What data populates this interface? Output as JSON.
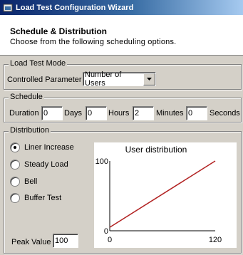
{
  "window": {
    "title": "Load Test Configuration Wizard"
  },
  "header": {
    "title": "Schedule & Distribution",
    "subtitle": "Choose from the following scheduling options."
  },
  "mode": {
    "legend": "Load Test Mode",
    "controlled_label": "Controlled Parameter",
    "controlled_value": "Number of Users"
  },
  "schedule": {
    "legend": "Schedule",
    "duration_label": "Duration",
    "days_value": "0",
    "days_label": "Days",
    "hours_value": "0",
    "hours_label": "Hours",
    "minutes_value": "2",
    "minutes_label": "Minutes",
    "seconds_value": "0",
    "seconds_label": "Seconds"
  },
  "distribution": {
    "legend": "Distribution",
    "options": [
      {
        "label": "Liner Increase",
        "selected": true
      },
      {
        "label": "Steady Load",
        "selected": false
      },
      {
        "label": "Bell",
        "selected": false
      },
      {
        "label": "Buffer Test",
        "selected": false
      }
    ],
    "peak_label": "Peak Value",
    "peak_value": "100"
  },
  "chart_data": {
    "type": "line",
    "title": "User distribution",
    "x": [
      0,
      120
    ],
    "series": [
      {
        "values": [
          5,
          100
        ]
      }
    ],
    "xticks": [
      "0",
      "120"
    ],
    "yticks": [
      "0",
      "100"
    ],
    "xlim": [
      0,
      120
    ],
    "ylim": [
      0,
      100
    ],
    "line_color": "#b22222",
    "grid": false
  }
}
